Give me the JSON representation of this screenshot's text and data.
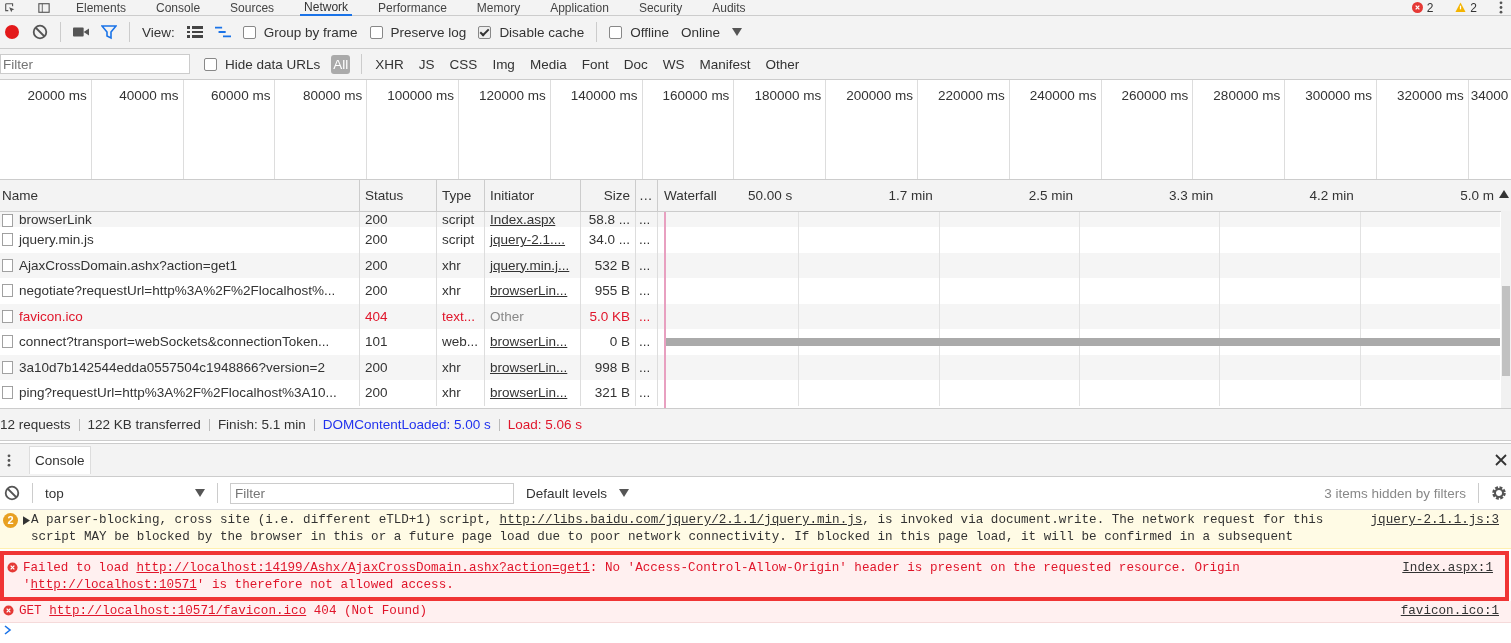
{
  "panel_tabs": [
    {
      "label": "Elements",
      "selected": false
    },
    {
      "label": "Console",
      "selected": false
    },
    {
      "label": "Sources",
      "selected": false
    },
    {
      "label": "Network",
      "selected": true
    },
    {
      "label": "Performance",
      "selected": false
    },
    {
      "label": "Memory",
      "selected": false
    },
    {
      "label": "Application",
      "selected": false
    },
    {
      "label": "Security",
      "selected": false
    },
    {
      "label": "Audits",
      "selected": false
    }
  ],
  "issue_counts": {
    "errors": "2",
    "warnings": "2"
  },
  "toolbar": {
    "recording": true,
    "filter_active": true,
    "view_label": "View:",
    "large_rows": false,
    "overview": true,
    "checkboxes": [
      {
        "label": "Group by frame",
        "checked": false
      },
      {
        "label": "Preserve log",
        "checked": false
      },
      {
        "label": "Disable cache",
        "checked": true
      },
      {
        "label": "Offline",
        "checked": false
      }
    ],
    "throttling": "Online"
  },
  "filter_bar": {
    "placeholder": "Filter",
    "hide_data_urls": {
      "label": "Hide data URLs",
      "checked": false
    },
    "types": [
      {
        "label": "All",
        "selected": true
      },
      {
        "label": "XHR",
        "selected": false
      },
      {
        "label": "JS",
        "selected": false
      },
      {
        "label": "CSS",
        "selected": false
      },
      {
        "label": "Img",
        "selected": false
      },
      {
        "label": "Media",
        "selected": false
      },
      {
        "label": "Font",
        "selected": false
      },
      {
        "label": "Doc",
        "selected": false
      },
      {
        "label": "WS",
        "selected": false
      },
      {
        "label": "Manifest",
        "selected": false
      },
      {
        "label": "Other",
        "selected": false
      }
    ]
  },
  "overview_ticks": [
    "20000 ms",
    "40000 ms",
    "60000 ms",
    "80000 ms",
    "100000 ms",
    "120000 ms",
    "140000 ms",
    "160000 ms",
    "180000 ms",
    "200000 ms",
    "220000 ms",
    "240000 ms",
    "260000 ms",
    "280000 ms",
    "300000 ms",
    "320000 ms",
    "34000"
  ],
  "table": {
    "columns": [
      "Name",
      "Status",
      "Type",
      "Initiator",
      "Size",
      "…",
      "Waterfall"
    ],
    "waterfall_ticks": [
      "50.00 s",
      "1.7 min",
      "2.5 min",
      "3.3 min",
      "4.2 min",
      "5.0 m"
    ],
    "rows": [
      {
        "name": "browserLink",
        "status": "200",
        "type": "script",
        "initiator": "Index.aspx",
        "initiator_link": true,
        "size": "58.8 ...",
        "more": "...",
        "error": false,
        "kind": "request"
      },
      {
        "name": "jquery.min.js",
        "status": "200",
        "type": "script",
        "initiator": "jquery-2.1....",
        "initiator_link": true,
        "size": "34.0 ...",
        "more": "...",
        "error": false,
        "kind": "request"
      },
      {
        "name": "AjaxCrossDomain.ashx?action=get1",
        "status": "200",
        "type": "xhr",
        "initiator": "jquery.min.j...",
        "initiator_link": true,
        "size": "532 B",
        "more": "...",
        "error": false,
        "kind": "request"
      },
      {
        "name": "negotiate?requestUrl=http%3A%2F%2Flocalhost%...",
        "status": "200",
        "type": "xhr",
        "initiator": "browserLin...",
        "initiator_link": true,
        "size": "955 B",
        "more": "...",
        "error": false,
        "kind": "request"
      },
      {
        "name": "favicon.ico",
        "status": "404",
        "type": "text...",
        "initiator": "Other",
        "initiator_link": false,
        "size": "5.0 KB",
        "more": "...",
        "error": true,
        "kind": "request"
      },
      {
        "name": "connect?transport=webSockets&connectionToken...",
        "status": "101",
        "type": "web...",
        "initiator": "browserLin...",
        "initiator_link": true,
        "size": "0 B",
        "more": "...",
        "error": false,
        "kind": "websocket"
      },
      {
        "name": "3a10d7b142544edda0557504c1948866?version=2",
        "status": "200",
        "type": "xhr",
        "initiator": "browserLin...",
        "initiator_link": true,
        "size": "998 B",
        "more": "...",
        "error": false,
        "kind": "request"
      },
      {
        "name": "ping?requestUrl=http%3A%2F%2Flocalhost%3A10...",
        "status": "200",
        "type": "xhr",
        "initiator": "browserLin...",
        "initiator_link": true,
        "size": "321 B",
        "more": "...",
        "error": false,
        "kind": "request"
      }
    ]
  },
  "summary": [
    {
      "text": "12 requests",
      "kind": "plain"
    },
    {
      "text": "122 KB transferred",
      "kind": "plain"
    },
    {
      "text": "Finish: 5.1 min",
      "kind": "plain"
    },
    {
      "text": "DOMContentLoaded: 5.00 s",
      "kind": "dom"
    },
    {
      "text": "Load: 5.06 s",
      "kind": "load"
    }
  ],
  "drawer": {
    "tabs": [
      {
        "label": "Console",
        "selected": true
      }
    ],
    "context": "top",
    "filter_placeholder": "Filter",
    "levels": "Default levels",
    "hidden_note": "3 items hidden by filters"
  },
  "messages": [
    {
      "kind": "warning",
      "count": "2",
      "highlighted": false,
      "parts": [
        {
          "text": "A parser-blocking, cross site (i.e. different eTLD+1) script, ",
          "link": false
        },
        {
          "text": "http://libs.baidu.com/jquery/2.1.1/jquery.min.js",
          "link": true
        },
        {
          "text": ", is invoked via document.write. The network request for this script MAY be blocked by the browser in this or a future page load due to poor network connectivity. If blocked in this page load, it will be confirmed in a subsequent",
          "link": false
        }
      ],
      "source": "jquery-2.1.1.js:3"
    },
    {
      "kind": "error",
      "highlighted": true,
      "parts": [
        {
          "text": "Failed to load ",
          "link": false
        },
        {
          "text": "http://localhost:14199/Ashx/AjaxCrossDomain.ashx?action=get1",
          "link": true
        },
        {
          "text": ": No 'Access-Control-Allow-Origin' header is present on the requested resource. Origin '",
          "link": false
        },
        {
          "text": "http://localhost:10571",
          "link": true
        },
        {
          "text": "' is therefore not allowed access.",
          "link": false
        }
      ],
      "source": "Index.aspx:1"
    },
    {
      "kind": "error",
      "highlighted": false,
      "parts": [
        {
          "text": "GET ",
          "link": false
        },
        {
          "text": "http://localhost:10571/favicon.ico",
          "link": true
        },
        {
          "text": " 404 (Not Found)",
          "link": false
        }
      ],
      "source": "favicon.ico:1"
    }
  ]
}
